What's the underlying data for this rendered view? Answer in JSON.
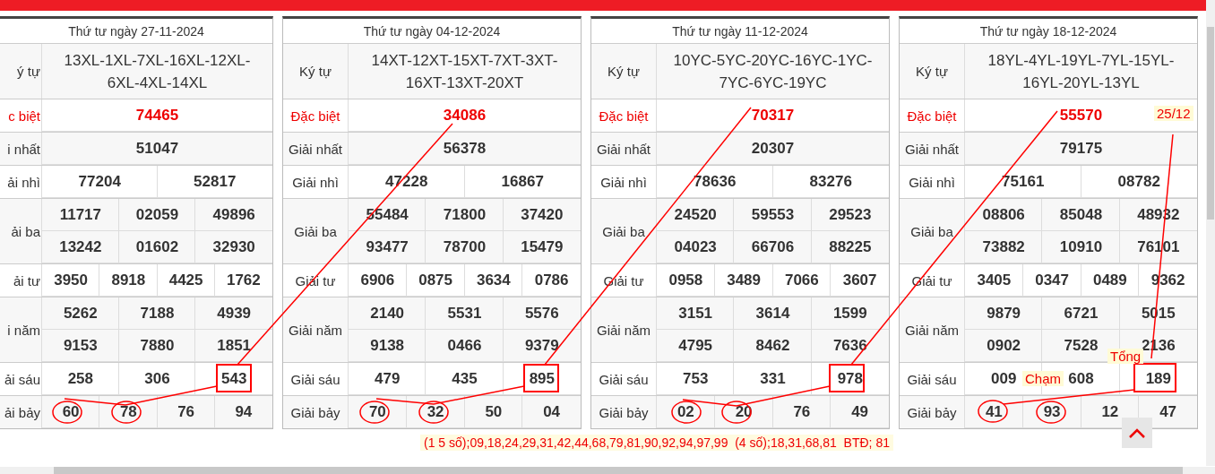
{
  "draws": [
    {
      "date": "Thứ tư ngày 27-11-2024",
      "rows": [
        {
          "kind": "code",
          "label": "ý tự",
          "values": [
            "13XL-1XL-7XL-16XL-12XL-6XL-4XL-14XL"
          ]
        },
        {
          "kind": "special",
          "label": "c biệt",
          "values": [
            "74465"
          ]
        },
        {
          "kind": "prize",
          "label": "i nhất",
          "values": [
            "51047"
          ]
        },
        {
          "kind": "prize",
          "label": "ải nhì",
          "values": [
            "77204",
            "52817"
          ]
        },
        {
          "kind": "prize",
          "label": "ải ba",
          "values": [
            "11717",
            "02059",
            "49896",
            "13242",
            "01602",
            "32930"
          ]
        },
        {
          "kind": "prize",
          "label": "ải tư",
          "values": [
            "3950",
            "8918",
            "4425",
            "1762"
          ]
        },
        {
          "kind": "prize",
          "label": "i năm",
          "values": [
            "5262",
            "7188",
            "4939",
            "9153",
            "7880",
            "1851"
          ]
        },
        {
          "kind": "prize",
          "label": "ải sáu",
          "values": [
            "258",
            "306",
            "543"
          ]
        },
        {
          "kind": "prize",
          "label": "ải bảy",
          "values": [
            "60",
            "78",
            "76",
            "94"
          ]
        }
      ]
    },
    {
      "date": "Thứ tư ngày 04-12-2024",
      "rows": [
        {
          "kind": "code",
          "label": "Ký tự",
          "values": [
            "14XT-12XT-15XT-7XT-3XT-16XT-13XT-20XT"
          ]
        },
        {
          "kind": "special",
          "label": "Đặc biệt",
          "values": [
            "34086"
          ]
        },
        {
          "kind": "prize",
          "label": "Giải nhất",
          "values": [
            "56378"
          ]
        },
        {
          "kind": "prize",
          "label": "Giải nhì",
          "values": [
            "47228",
            "16867"
          ]
        },
        {
          "kind": "prize",
          "label": "Giải ba",
          "values": [
            "55484",
            "71800",
            "37420",
            "93477",
            "78700",
            "15479"
          ]
        },
        {
          "kind": "prize",
          "label": "Giải tư",
          "values": [
            "6906",
            "0875",
            "3634",
            "0786"
          ]
        },
        {
          "kind": "prize",
          "label": "Giải năm",
          "values": [
            "2140",
            "5531",
            "5576",
            "9138",
            "0466",
            "9379"
          ]
        },
        {
          "kind": "prize",
          "label": "Giải sáu",
          "values": [
            "479",
            "435",
            "895"
          ]
        },
        {
          "kind": "prize",
          "label": "Giải bảy",
          "values": [
            "70",
            "32",
            "50",
            "04"
          ]
        }
      ]
    },
    {
      "date": "Thứ tư ngày 11-12-2024",
      "rows": [
        {
          "kind": "code",
          "label": "Ký tự",
          "values": [
            "10YC-5YC-20YC-16YC-1YC-7YC-6YC-19YC"
          ]
        },
        {
          "kind": "special",
          "label": "Đặc biệt",
          "values": [
            "70317"
          ]
        },
        {
          "kind": "prize",
          "label": "Giải nhất",
          "values": [
            "20307"
          ]
        },
        {
          "kind": "prize",
          "label": "Giải nhì",
          "values": [
            "78636",
            "83276"
          ]
        },
        {
          "kind": "prize",
          "label": "Giải ba",
          "values": [
            "24520",
            "59553",
            "29523",
            "04023",
            "66706",
            "88225"
          ]
        },
        {
          "kind": "prize",
          "label": "Giải tư",
          "values": [
            "0958",
            "3489",
            "7066",
            "3607"
          ]
        },
        {
          "kind": "prize",
          "label": "Giải năm",
          "values": [
            "3151",
            "3614",
            "1599",
            "4795",
            "8462",
            "7636"
          ]
        },
        {
          "kind": "prize",
          "label": "Giải sáu",
          "values": [
            "753",
            "331",
            "978"
          ]
        },
        {
          "kind": "prize",
          "label": "Giải bảy",
          "values": [
            "02",
            "20",
            "76",
            "49"
          ]
        }
      ]
    },
    {
      "date": "Thứ tư ngày 18-12-2024",
      "rows": [
        {
          "kind": "code",
          "label": "Ký tự",
          "values": [
            "18YL-4YL-19YL-7YL-15YL-16YL-20YL-13YL"
          ]
        },
        {
          "kind": "special",
          "label": "Đặc biệt",
          "values": [
            "55570"
          ]
        },
        {
          "kind": "prize",
          "label": "Giải nhất",
          "values": [
            "79175"
          ]
        },
        {
          "kind": "prize",
          "label": "Giải nhì",
          "values": [
            "75161",
            "08782"
          ]
        },
        {
          "kind": "prize",
          "label": "Giải ba",
          "values": [
            "08806",
            "85048",
            "48932",
            "73882",
            "10910",
            "76101"
          ]
        },
        {
          "kind": "prize",
          "label": "Giải tư",
          "values": [
            "3405",
            "0347",
            "0489",
            "9362"
          ]
        },
        {
          "kind": "prize",
          "label": "Giải năm",
          "values": [
            "9879",
            "6721",
            "5015",
            "0902",
            "7528",
            "2136"
          ]
        },
        {
          "kind": "prize",
          "label": "Giải sáu",
          "values": [
            "009",
            "608",
            "189"
          ]
        },
        {
          "kind": "prize",
          "label": "Giải bảy",
          "values": [
            "41",
            "93",
            "12",
            "47"
          ]
        }
      ]
    }
  ],
  "annotations": [
    {
      "text": "25/12"
    },
    {
      "text": "Tổng"
    },
    {
      "text": "Chạm"
    }
  ],
  "summary": "(1 5 số);09,18,24,29,31,42,44,68,79,81,90,92,94,97,99  (4 số);18,31,68,81  BTĐ; 81"
}
